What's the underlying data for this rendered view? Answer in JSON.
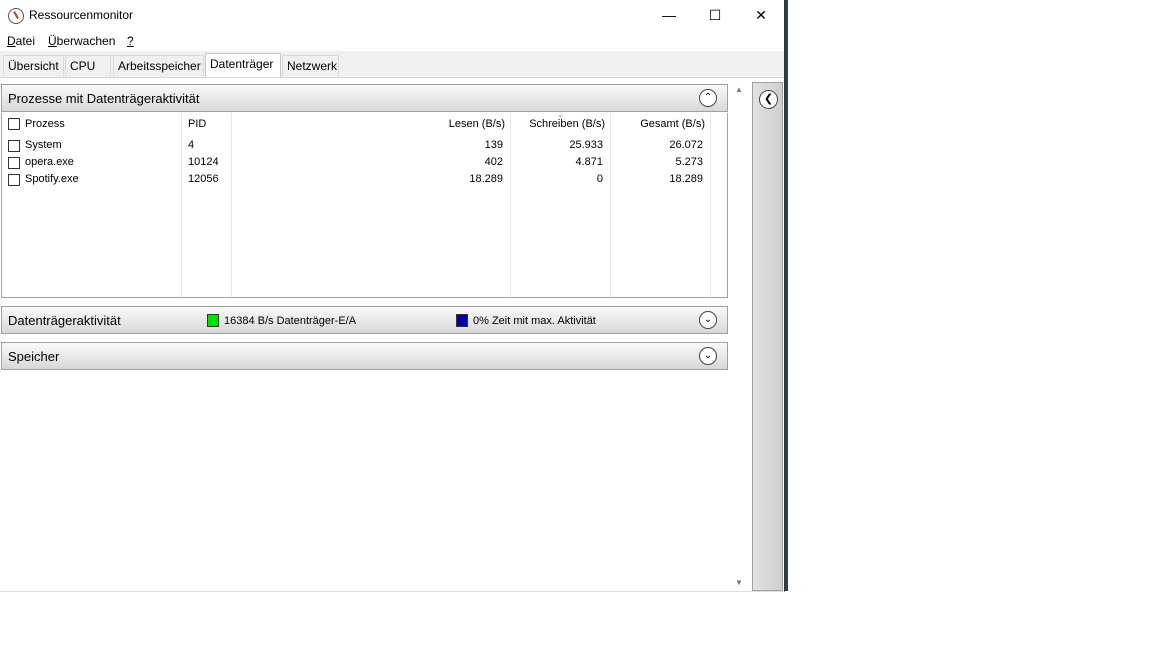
{
  "window": {
    "title": "Ressourcenmonitor",
    "min_icon": "minimize-icon",
    "max_icon": "maximize-icon",
    "close_icon": "close-icon"
  },
  "menu": [
    {
      "label_pre": "",
      "accel": "D",
      "label_post": "atei"
    },
    {
      "label_pre": "",
      "accel": "Ü",
      "label_post": "berwachen"
    },
    {
      "label_pre": "",
      "accel": "?",
      "label_post": ""
    }
  ],
  "tabs": [
    "Übersicht",
    "CPU",
    "Arbeitsspeicher",
    "Datenträger",
    "Netzwerk"
  ],
  "active_tab": "Datenträger",
  "processes_section": {
    "title": "Prozesse mit Datenträgeraktivität",
    "columns": [
      "Prozess",
      "PID",
      "Lesen (B/s)",
      "Schreiben (B/s)",
      "Gesamt (B/s)"
    ],
    "rows": [
      {
        "name": "System",
        "pid": "4",
        "read": "139",
        "write": "25.933",
        "total": "26.072"
      },
      {
        "name": "opera.exe",
        "pid": "10124",
        "read": "402",
        "write": "4.871",
        "total": "5.273"
      },
      {
        "name": "Spotify.exe",
        "pid": "12056",
        "read": "18.289",
        "write": "0",
        "total": "18.289"
      }
    ]
  },
  "disk_activity_section": {
    "title": "Datenträgeraktivität",
    "legend1": {
      "text": "16384 B/s Datenträger-E/A",
      "color": "#00e000"
    },
    "legend2": {
      "text": "0% Zeit mit max. Aktivität",
      "color": "#0000a0"
    }
  },
  "storage_section": {
    "title": "Speicher"
  }
}
